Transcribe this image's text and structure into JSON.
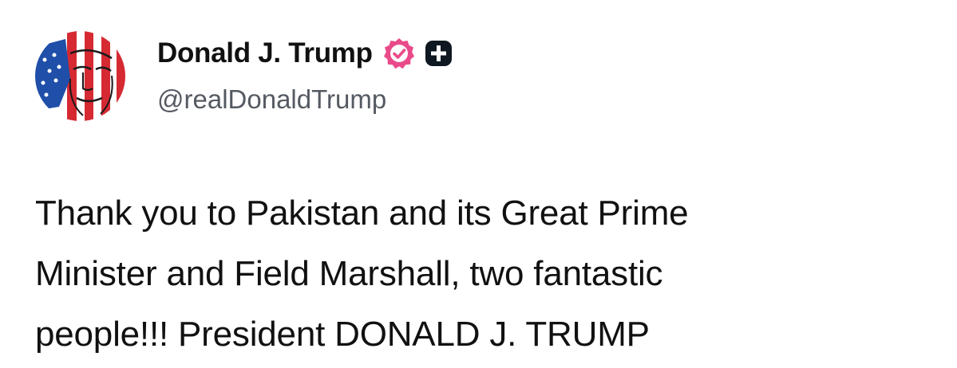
{
  "author": {
    "display_name": "Donald J. Trump",
    "handle": "@realDonaldTrump",
    "verified_badge_icon": "verified-check-badge-icon",
    "verified_badge_color": "#e94b8a",
    "subscription_badge_icon": "plus-square-icon"
  },
  "post": {
    "text_lines": [
      "Thank you to Pakistan and its Great Prime",
      "Minister and Field Marshall, two fantastic",
      "people!!! President DONALD J. TRUMP"
    ]
  },
  "colors": {
    "text_primary": "#111111",
    "text_secondary": "#555a62",
    "background": "#ffffff",
    "avatar_red": "#d62a33",
    "avatar_blue": "#1f4fa8"
  }
}
